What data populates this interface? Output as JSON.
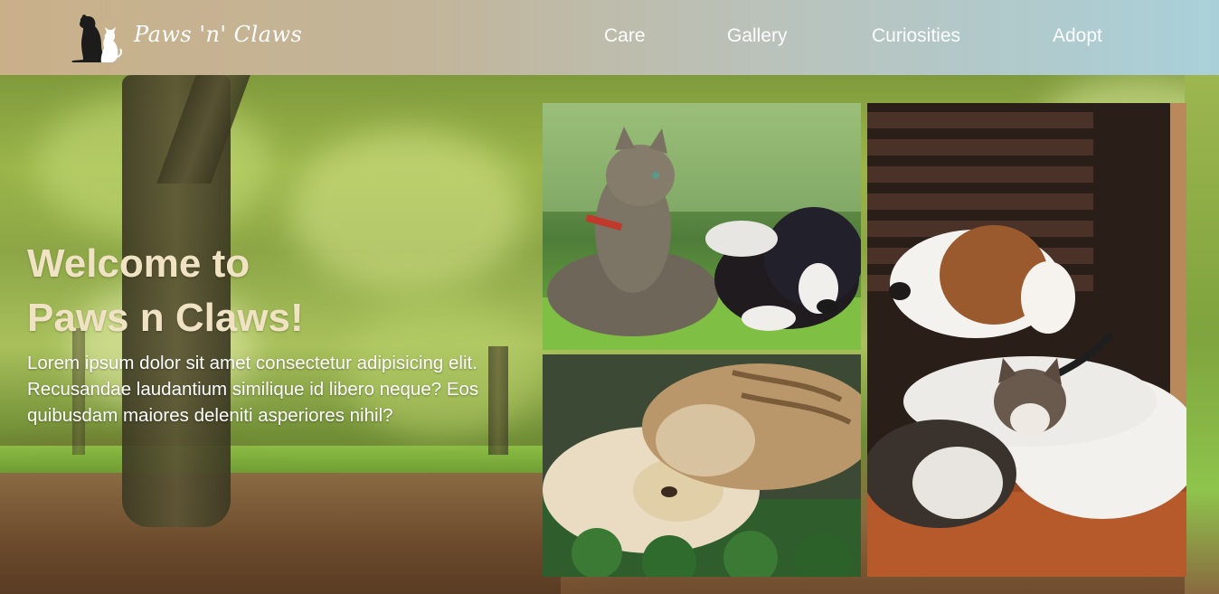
{
  "site": {
    "brand": "Paws 'n' Claws"
  },
  "nav": {
    "items": [
      {
        "label": "Care"
      },
      {
        "label": "Gallery"
      },
      {
        "label": "Curiosities"
      },
      {
        "label": "Adopt"
      }
    ]
  },
  "hero": {
    "title_line1": "Welcome to",
    "title_line2": "Paws n Claws!",
    "body": "Lorem ipsum dolor sit amet consectetur adipisicing elit. Recusandae laudantium similique id libero neque? Eos quibusdam maiores deleniti asperiores nihil?"
  },
  "colors": {
    "header_left": "#c9b089",
    "header_right": "#a9d0d9",
    "title": "#efe3c3",
    "body_text": "#ffffff",
    "nav_text": "#ffffff"
  },
  "icons": {
    "logo": "dog-and-cat-silhouette-icon"
  }
}
